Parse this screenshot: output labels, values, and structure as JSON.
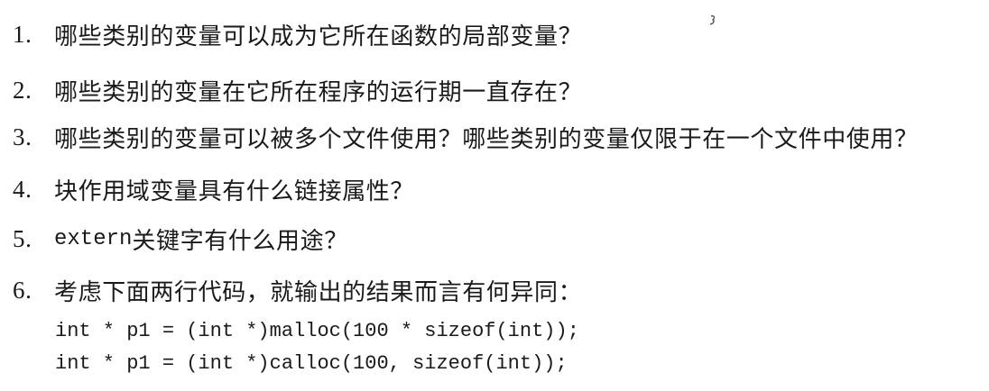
{
  "questions": [
    {
      "number": "1.",
      "text": "哪些类别的变量可以成为它所在函数的局部变量？"
    },
    {
      "number": "2.",
      "text": "哪些类别的变量在它所在程序的运行期一直存在？"
    },
    {
      "number": "3.",
      "text": "哪些类别的变量可以被多个文件使用？哪些类别的变量仅限于在一个文件中使用？"
    },
    {
      "number": "4.",
      "text": "块作用域变量具有什么链接属性？"
    },
    {
      "number": "5.",
      "keyword": "extern",
      "text": " 关键字有什么用途？"
    },
    {
      "number": "6.",
      "text": "考虑下面两行代码，就输出的结果而言有何异同："
    }
  ],
  "code_lines": [
    "int * p1 = (int *)malloc(100 * sizeof(int));",
    "int * p1 = (int *)calloc(100, sizeof(int));"
  ]
}
